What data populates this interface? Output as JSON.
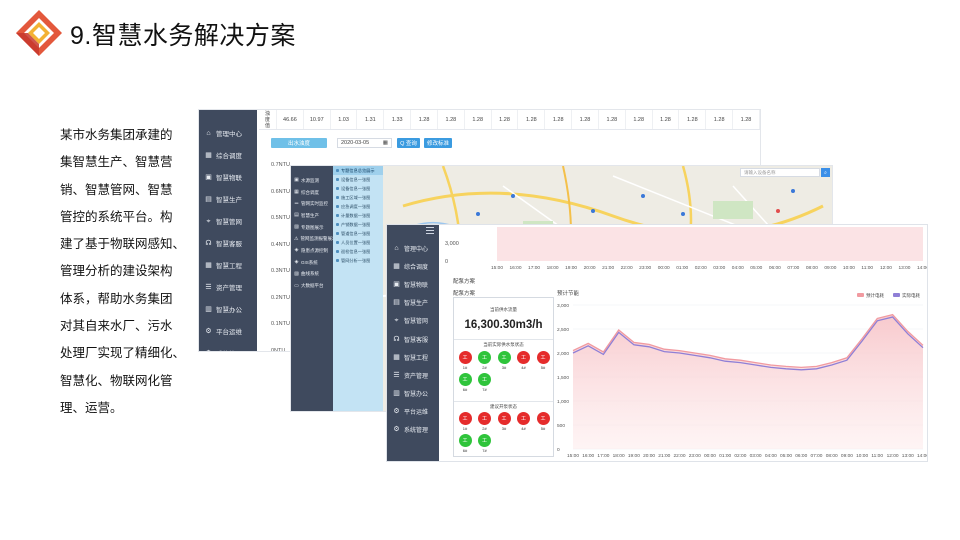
{
  "slide": {
    "title": "9.智慧水务解决方案",
    "description_lines": [
      "某市水务集团承建的",
      "集智慧生产、智慧营",
      "销、智慧管网、智慧",
      "管控的系统平台。构",
      "建了基于物联网感知、",
      "管理分析的建设架构",
      "体系，帮助水务集团",
      "对其自来水厂、污水",
      "处理厂实现了精细化、",
      "智慧化、物联网化管",
      "理、运营。"
    ]
  },
  "colors": {
    "nav_bg": "#3f4a5e",
    "submenu_bg": "#c3e3f4",
    "accent": "#6fc0e8",
    "pump_on": "#e52c2c",
    "pump_off": "#2fc43b",
    "series_forecast": "#f19aa0",
    "series_actual": "#8f7fd6"
  },
  "shot1": {
    "nav": [
      {
        "icon": "home-icon",
        "label": "管理中心"
      },
      {
        "icon": "grid-icon",
        "label": "综合调度"
      },
      {
        "icon": "box-icon",
        "label": "智慧物联"
      },
      {
        "icon": "factory-icon",
        "label": "智慧生产"
      },
      {
        "icon": "network-icon",
        "label": "智慧管网"
      },
      {
        "icon": "headset-icon",
        "label": "智慧客服"
      },
      {
        "icon": "grid-icon",
        "label": "智慧工程"
      },
      {
        "icon": "list-icon",
        "label": "资产管理"
      },
      {
        "icon": "office-icon",
        "label": "智慧办公"
      },
      {
        "icon": "gear-icon",
        "label": "平台运维"
      },
      {
        "icon": "gear-icon",
        "label": "系统管理"
      }
    ],
    "table_head": [
      "浊",
      "度",
      "值"
    ],
    "table_values": [
      "46.66",
      "10.97",
      "1.03",
      "1.31",
      "1.33",
      "1.28",
      "1.28",
      "1.28",
      "1.28",
      "1.28",
      "1.28",
      "1.28",
      "1.28",
      "1.28",
      "1.28",
      "1.28",
      "1.28",
      "1.28"
    ],
    "btn_water": "出水浊度",
    "date": "2020-03-05",
    "btn_query": "Q 查询",
    "btn_edit": "修改标准",
    "y_labels": [
      "0.7NTU",
      "0.6NTU",
      "0.5NTU",
      "0.4NTU",
      "0.3NTU",
      "0.2NTU",
      "0.1NTU",
      "0NTU"
    ]
  },
  "shot2": {
    "nav": [
      {
        "icon": "box-icon",
        "label": "水源监测"
      },
      {
        "icon": "grid-icon",
        "label": "综合调度"
      },
      {
        "icon": "pipe-icon",
        "label": "管网实时监控"
      },
      {
        "icon": "factory-icon",
        "label": "智慧生产"
      },
      {
        "icon": "chart-icon",
        "label": "专题图展示"
      },
      {
        "icon": "alarm-icon",
        "label": "管网监测报警展示"
      },
      {
        "icon": "map-icon",
        "label": "隐患点源控制"
      },
      {
        "icon": "map-icon",
        "label": "GIS系统"
      },
      {
        "icon": "chart-icon",
        "label": "曲线系统"
      },
      {
        "icon": "screen-icon",
        "label": "大数据平台"
      }
    ],
    "submenu": [
      "专题信息总览展示",
      "设备信息一张图",
      "设备信息一张图",
      "施工区域一张图",
      "应急调度一张图",
      "计量数据一张图",
      "产销数据一张图",
      "管道信息一张图",
      "人员位置一张图",
      "巡检信息一张图",
      "管网分析一张图"
    ],
    "search_placeholder": "请输入设备名称"
  },
  "shot3": {
    "nav": [
      {
        "icon": "home-icon",
        "label": "管理中心"
      },
      {
        "icon": "grid-icon",
        "label": "综合调度"
      },
      {
        "icon": "box-icon",
        "label": "智慧物联"
      },
      {
        "icon": "factory-icon",
        "label": "智慧生产"
      },
      {
        "icon": "network-icon",
        "label": "智慧管网"
      },
      {
        "icon": "headset-icon",
        "label": "智慧客服"
      },
      {
        "icon": "grid-icon",
        "label": "智慧工程"
      },
      {
        "icon": "list-icon",
        "label": "资产管理"
      },
      {
        "icon": "office-icon",
        "label": "智慧办公"
      },
      {
        "icon": "gear-icon",
        "label": "平台运维"
      },
      {
        "icon": "gear-icon",
        "label": "系统管理"
      }
    ],
    "section_label": "配泵方案",
    "panel_label": "配泵方案",
    "chart_label": "预计节能",
    "current_flow_label": "当前供水流量",
    "current_flow_value": "16,300.30m3/h",
    "current_status_label": "当前实际供水泵状态",
    "suggest_label": "建议开泵状态",
    "pump_char": "工",
    "current_pumps": [
      {
        "name": "1#",
        "state": "red"
      },
      {
        "name": "2#",
        "state": "green"
      },
      {
        "name": "3#",
        "state": "green"
      },
      {
        "name": "4#",
        "state": "red"
      },
      {
        "name": "5#",
        "state": "red"
      },
      {
        "name": "6#",
        "state": "green"
      },
      {
        "name": "7#",
        "state": "green"
      }
    ],
    "suggest_pumps": [
      {
        "name": "1#",
        "state": "red"
      },
      {
        "name": "2#",
        "state": "red"
      },
      {
        "name": "3#",
        "state": "red"
      },
      {
        "name": "4#",
        "state": "red"
      },
      {
        "name": "5#",
        "state": "red"
      },
      {
        "name": "6#",
        "state": "green"
      },
      {
        "name": "7#",
        "state": "green"
      }
    ]
  },
  "chart_data": [
    {
      "type": "area",
      "x": [
        "15:00",
        "16:00",
        "17:00",
        "18:00",
        "19:00",
        "20:00",
        "21:00",
        "22:00",
        "23:00",
        "00:00",
        "01:00",
        "02:00",
        "03:00",
        "04:00",
        "05:00",
        "06:00",
        "07:00",
        "08:00",
        "09:00",
        "10:00",
        "11:00",
        "12:00",
        "13:00",
        "14:00"
      ],
      "y_ticks": [
        "3,000",
        "0"
      ]
    },
    {
      "type": "line",
      "title": "预计节能",
      "x": [
        "15:00",
        "16:00",
        "17:00",
        "18:00",
        "19:00",
        "20:00",
        "21:00",
        "22:00",
        "23:00",
        "00:00",
        "01:00",
        "02:00",
        "03:00",
        "04:00",
        "05:00",
        "06:00",
        "07:00",
        "08:00",
        "09:00",
        "10:00",
        "11:00",
        "12:00",
        "13:00",
        "14:00"
      ],
      "y_ticks": [
        "3,000",
        "2,500",
        "2,000",
        "1,500",
        "1,000",
        "500",
        "0"
      ],
      "ylim": [
        0,
        3000
      ],
      "legend_position": "top-right",
      "series": [
        {
          "name": "预计电耗",
          "color": "#f19aa0",
          "values": [
            2050,
            2200,
            2020,
            2480,
            2220,
            2180,
            2080,
            2050,
            2000,
            1950,
            1880,
            1850,
            1800,
            1750,
            1720,
            1700,
            1720,
            1800,
            1900,
            2300,
            2720,
            2800,
            2450,
            2160
          ]
        },
        {
          "name": "实际电耗",
          "color": "#8f7fd6",
          "values": [
            2000,
            2150,
            1970,
            2430,
            2170,
            2130,
            2030,
            2000,
            1950,
            1900,
            1830,
            1800,
            1750,
            1700,
            1670,
            1650,
            1670,
            1750,
            1850,
            2250,
            2670,
            2750,
            2400,
            2110
          ]
        }
      ]
    }
  ]
}
